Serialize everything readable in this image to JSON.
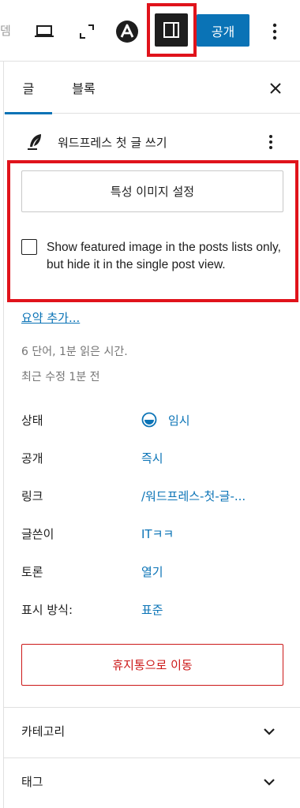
{
  "toolbar": {
    "faded_text": "뎀",
    "publish_label": "공개",
    "icons": [
      "laptop-icon",
      "expand-icon",
      "astra-icon",
      "sidebar-toggle-icon",
      "more-vertical-icon"
    ]
  },
  "tabs": [
    {
      "label": "글",
      "active": true
    },
    {
      "label": "블록",
      "active": false
    }
  ],
  "post": {
    "title": "워드프레스 첫 글 쓰기"
  },
  "featured_image": {
    "button_label": "특성 이미지 설정",
    "checkbox_label": "Show featured image in the posts lists only, but hide it in the single post view.",
    "checked": false
  },
  "excerpt": {
    "link_label": "요약 추가..."
  },
  "meta": {
    "word_count": "6 단어, 1분 읽은 시간.",
    "last_modified": "최근 수정 1분 전"
  },
  "properties": [
    {
      "label": "상태",
      "value": "임시"
    },
    {
      "label": "공개",
      "value": "즉시"
    },
    {
      "label": "링크",
      "value": "/워드프레스-첫-글-..."
    },
    {
      "label": "글쓴이",
      "value": "ITㅋㅋ"
    },
    {
      "label": "토론",
      "value": "열기"
    },
    {
      "label": "표시 방식:",
      "value": "표준"
    }
  ],
  "trash_label": "휴지통으로 이동",
  "sections": [
    {
      "label": "카테고리"
    },
    {
      "label": "태그"
    }
  ],
  "colors": {
    "accent": "#0a73b6",
    "highlight": "#e0131b",
    "danger": "#cc1818"
  }
}
